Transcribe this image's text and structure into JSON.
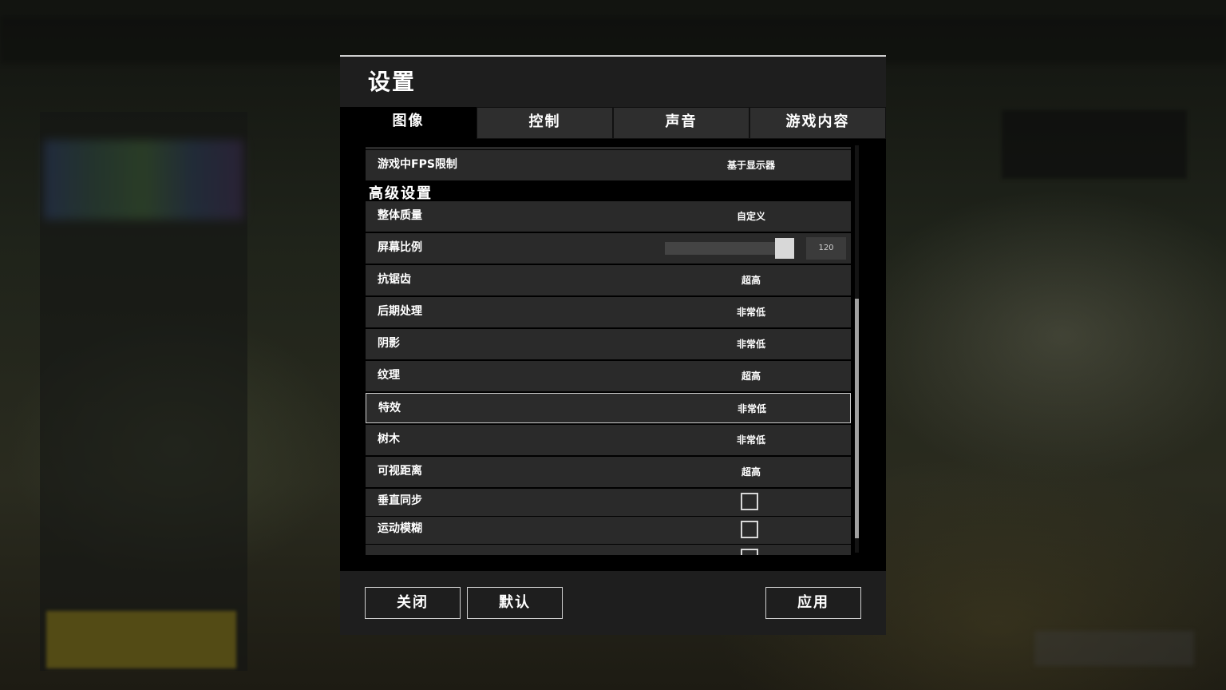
{
  "dialog": {
    "title": "设置"
  },
  "tabs": [
    {
      "label": "图像",
      "active": true
    },
    {
      "label": "控制",
      "active": false
    },
    {
      "label": "声音",
      "active": false
    },
    {
      "label": "游戏内容",
      "active": false
    }
  ],
  "settings": {
    "fps_limit": {
      "label": "游戏中FPS限制",
      "value": "基于显示器"
    },
    "advanced_heading": "高级设置",
    "overall_quality": {
      "label": "整体质量",
      "value": "自定义"
    },
    "screen_scale": {
      "label": "屏幕比例",
      "value": "120",
      "min": 70,
      "max": 120
    },
    "anti_aliasing": {
      "label": "抗锯齿",
      "value": "超高"
    },
    "post_processing": {
      "label": "后期处理",
      "value": "非常低"
    },
    "shadows": {
      "label": "阴影",
      "value": "非常低"
    },
    "textures": {
      "label": "纹理",
      "value": "超高"
    },
    "effects": {
      "label": "特效",
      "value": "非常低"
    },
    "foliage": {
      "label": "树木",
      "value": "非常低"
    },
    "view_distance": {
      "label": "可视距离",
      "value": "超高"
    },
    "vsync": {
      "label": "垂直同步",
      "checked": false
    },
    "motion_blur": {
      "label": "运动模糊",
      "checked": false
    }
  },
  "footer": {
    "close_label": "关闭",
    "default_label": "默认",
    "apply_label": "应用"
  }
}
